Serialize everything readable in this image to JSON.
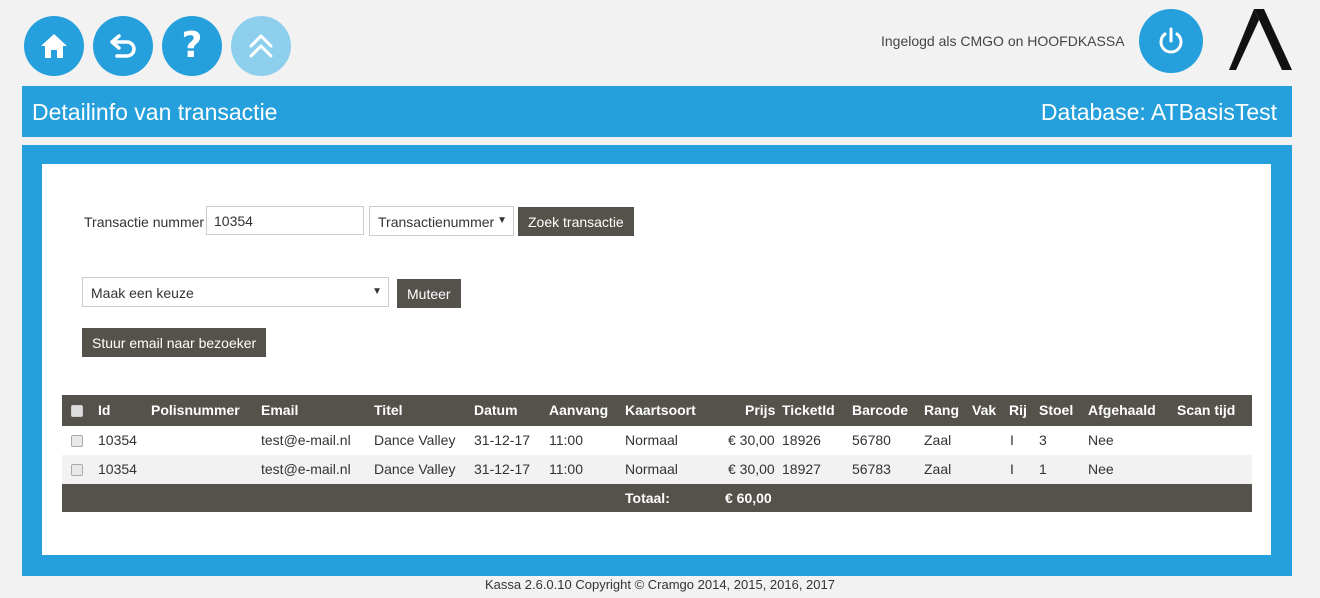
{
  "nav": {
    "home_label": "home",
    "back_label": "back",
    "help_glyph": "?",
    "up_label": "up"
  },
  "session": {
    "logged_in_text": "Ingelogd als CMGO on HOOFDKASSA"
  },
  "header": {
    "title": "Detailinfo van transactie",
    "database": "Database: ATBasisTest"
  },
  "search": {
    "label": "Transactie nummer",
    "value": "10354",
    "type_selected": "Transactienummer",
    "search_button": "Zoek transactie"
  },
  "action": {
    "select_selected": "Maak een keuze",
    "mutate_button": "Muteer",
    "email_button": "Stuur email naar bezoeker"
  },
  "table": {
    "headers": {
      "id": "Id",
      "polis": "Polisnummer",
      "email": "Email",
      "titel": "Titel",
      "datum": "Datum",
      "aanvang": "Aanvang",
      "kaartsoort": "Kaartsoort",
      "prijs": "Prijs",
      "ticketid": "TicketId",
      "barcode": "Barcode",
      "rang": "Rang",
      "vak": "Vak",
      "rij": "Rij",
      "stoel": "Stoel",
      "afgehaald": "Afgehaald",
      "scantijd": "Scan tijd"
    },
    "rows": [
      {
        "id": "10354",
        "polis": "",
        "email": "test@e-mail.nl",
        "titel": "Dance Valley",
        "datum": "31-12-17",
        "aanvang": "11:00",
        "kaartsoort": "Normaal",
        "prijs": "€ 30,00",
        "ticketid": "18926",
        "barcode": "56780",
        "rang": "Zaal",
        "vak": "",
        "rij": "I",
        "stoel": "3",
        "afgehaald": "Nee",
        "scantijd": ""
      },
      {
        "id": "10354",
        "polis": "",
        "email": "test@e-mail.nl",
        "titel": "Dance Valley",
        "datum": "31-12-17",
        "aanvang": "11:00",
        "kaartsoort": "Normaal",
        "prijs": "€ 30,00",
        "ticketid": "18927",
        "barcode": "56783",
        "rang": "Zaal",
        "vak": "",
        "rij": "I",
        "stoel": "1",
        "afgehaald": "Nee",
        "scantijd": ""
      }
    ],
    "total_label": "Totaal:",
    "total_value": "€ 60,00"
  },
  "footer": {
    "copyright": "Kassa 2.6.0.10 Copyright © Cramgo 2014, 2015, 2016, 2017"
  },
  "colors": {
    "brand_blue": "#25a0dc",
    "brand_blue_light": "#8fcfee",
    "button_dark": "#55524c"
  }
}
